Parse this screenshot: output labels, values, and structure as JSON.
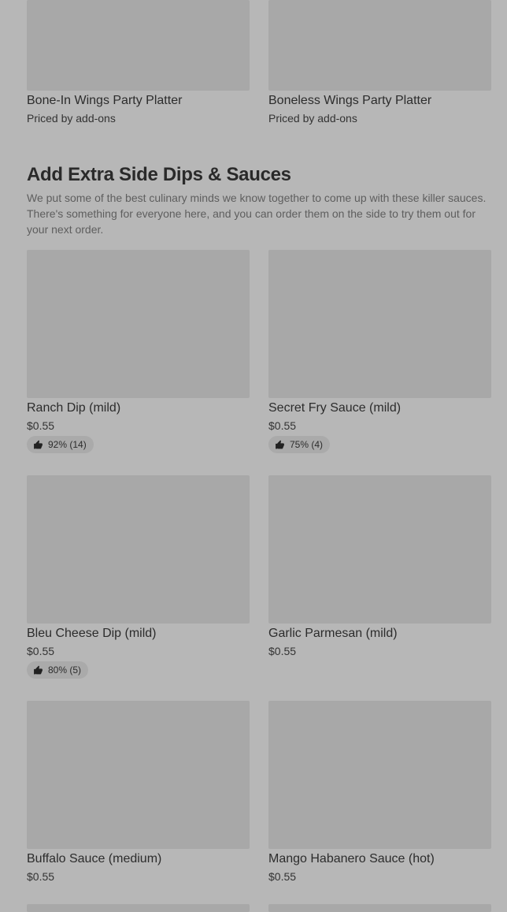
{
  "top_items": [
    {
      "name": "Bone-In Wings Party Platter",
      "price": "Priced by add-ons"
    },
    {
      "name": "Boneless Wings Party Platter",
      "price": "Priced by add-ons"
    }
  ],
  "section": {
    "title": "Add Extra Side Dips & Sauces",
    "description": "We put some of the best culinary minds we know together to come up with these killer sauces. There's something for everyone here, and you can order them on the side to try them out for your next order."
  },
  "items": [
    {
      "name": "Ranch Dip (mild)",
      "price": "$0.55",
      "rating": "92% (14)"
    },
    {
      "name": "Secret Fry Sauce (mild)",
      "price": "$0.55",
      "rating": "75% (4)"
    },
    {
      "name": "Bleu Cheese Dip (mild)",
      "price": "$0.55",
      "rating": "80% (5)"
    },
    {
      "name": "Garlic Parmesan (mild)",
      "price": "$0.55"
    },
    {
      "name": "Buffalo Sauce (medium)",
      "price": "$0.55"
    },
    {
      "name": "Mango Habanero Sauce (hot)",
      "price": "$0.55"
    }
  ],
  "icons": {
    "rating": "thumbs-up-icon"
  }
}
